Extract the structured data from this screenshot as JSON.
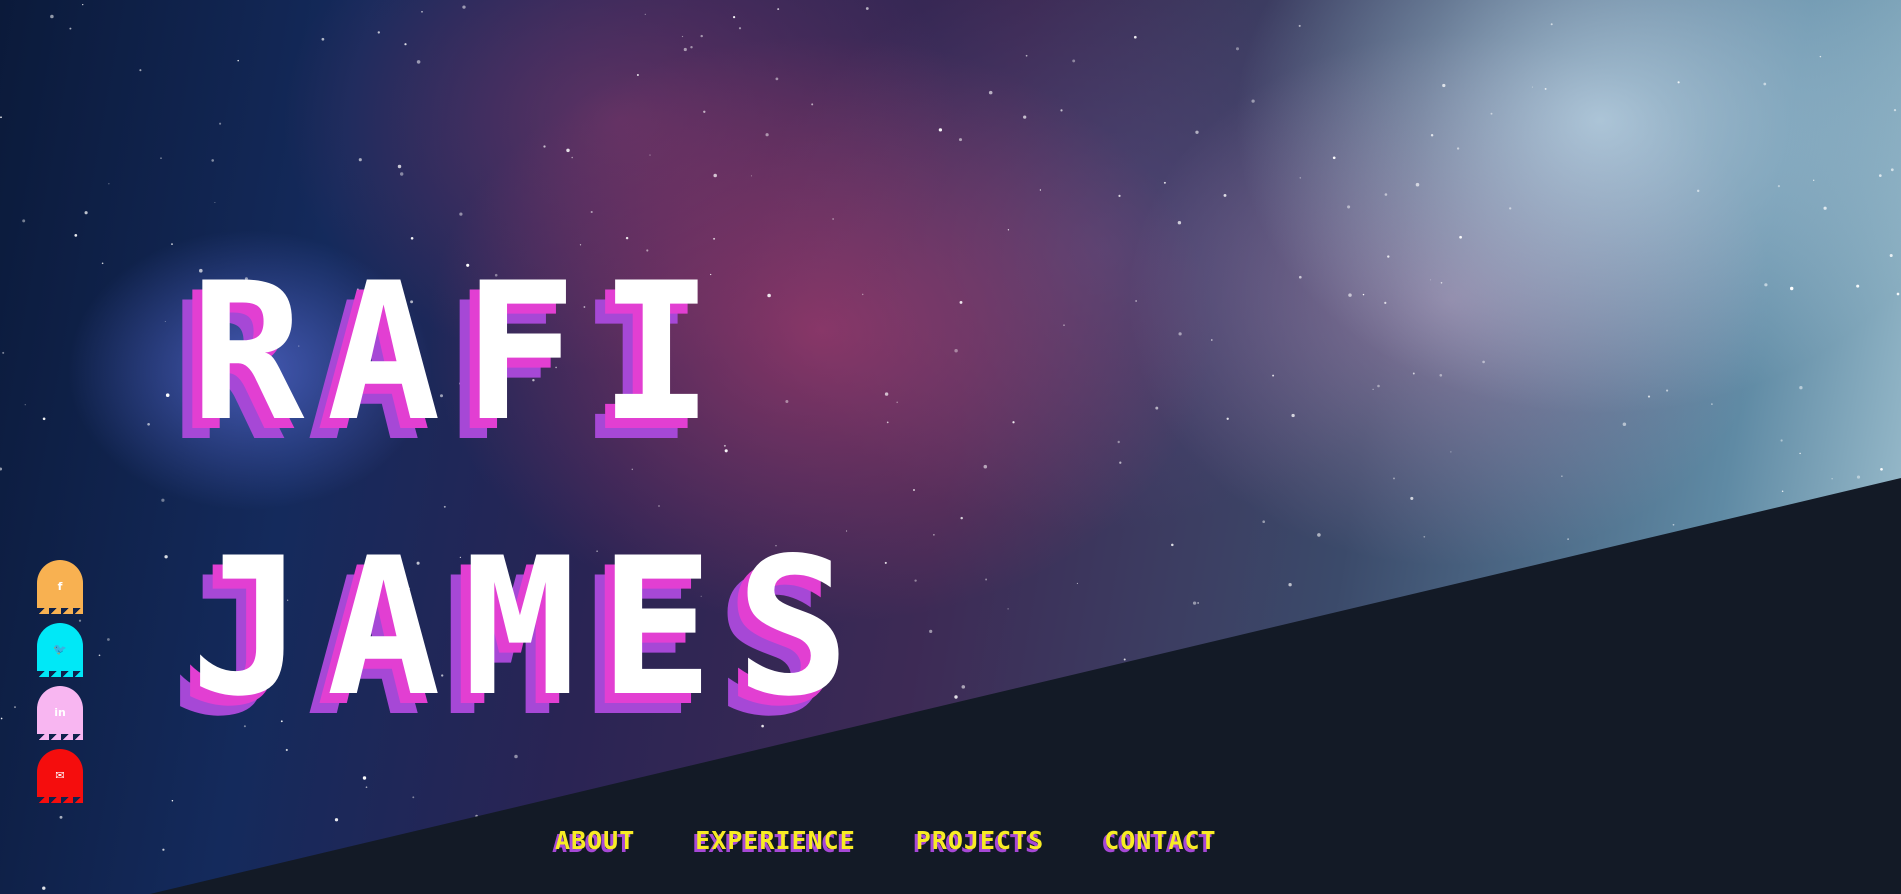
{
  "hero": {
    "first_name": "RAFI",
    "last_name": "JAMES"
  },
  "socials": [
    {
      "name": "facebook",
      "icon": "facebook-icon",
      "glyph": "f",
      "color": "#f8b151"
    },
    {
      "name": "twitter",
      "icon": "twitter-icon",
      "glyph": "🐦",
      "color": "#00e8f7"
    },
    {
      "name": "linkedin",
      "icon": "linkedin-icon",
      "glyph": "in",
      "color": "#f8b6f1"
    },
    {
      "name": "email",
      "icon": "mail-icon",
      "glyph": "✉",
      "color": "#f50d0d"
    }
  ],
  "nav": {
    "about": "ABOUT",
    "experience": "EXPERIENCE",
    "projects": "PROJECTS",
    "contact": "CONTACT"
  },
  "colors": {
    "bottom_panel": "#131a26",
    "name_shadow_pink": "#e23fd2",
    "name_shadow_purple": "#a648d6",
    "nav_text": "#f8ec24"
  }
}
